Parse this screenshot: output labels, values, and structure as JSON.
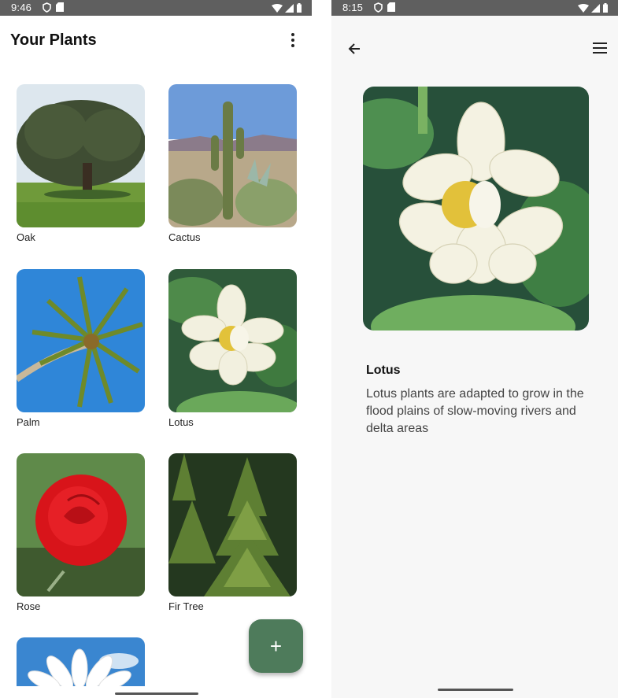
{
  "left": {
    "status": {
      "time": "9:46"
    },
    "title": "Your Plants",
    "plants": [
      {
        "name": "Oak"
      },
      {
        "name": "Cactus"
      },
      {
        "name": "Palm"
      },
      {
        "name": "Lotus"
      },
      {
        "name": "Rose"
      },
      {
        "name": "Fir Tree"
      },
      {
        "name": ""
      }
    ],
    "fab_label": "+"
  },
  "right": {
    "status": {
      "time": "8:15"
    },
    "detail": {
      "title": "Lotus",
      "description": "Lotus plants are adapted to grow in the flood plains of slow-moving rivers and delta areas"
    }
  },
  "icons": [
    "vpn-key-icon",
    "sd-card-icon",
    "wifi-icon",
    "signal-icon",
    "battery-icon",
    "more-vert-icon",
    "back-arrow-icon",
    "menu-icon",
    "add-icon"
  ],
  "colors": {
    "fab": "#4e7b5b",
    "statusbar": "#5f5f5f"
  }
}
